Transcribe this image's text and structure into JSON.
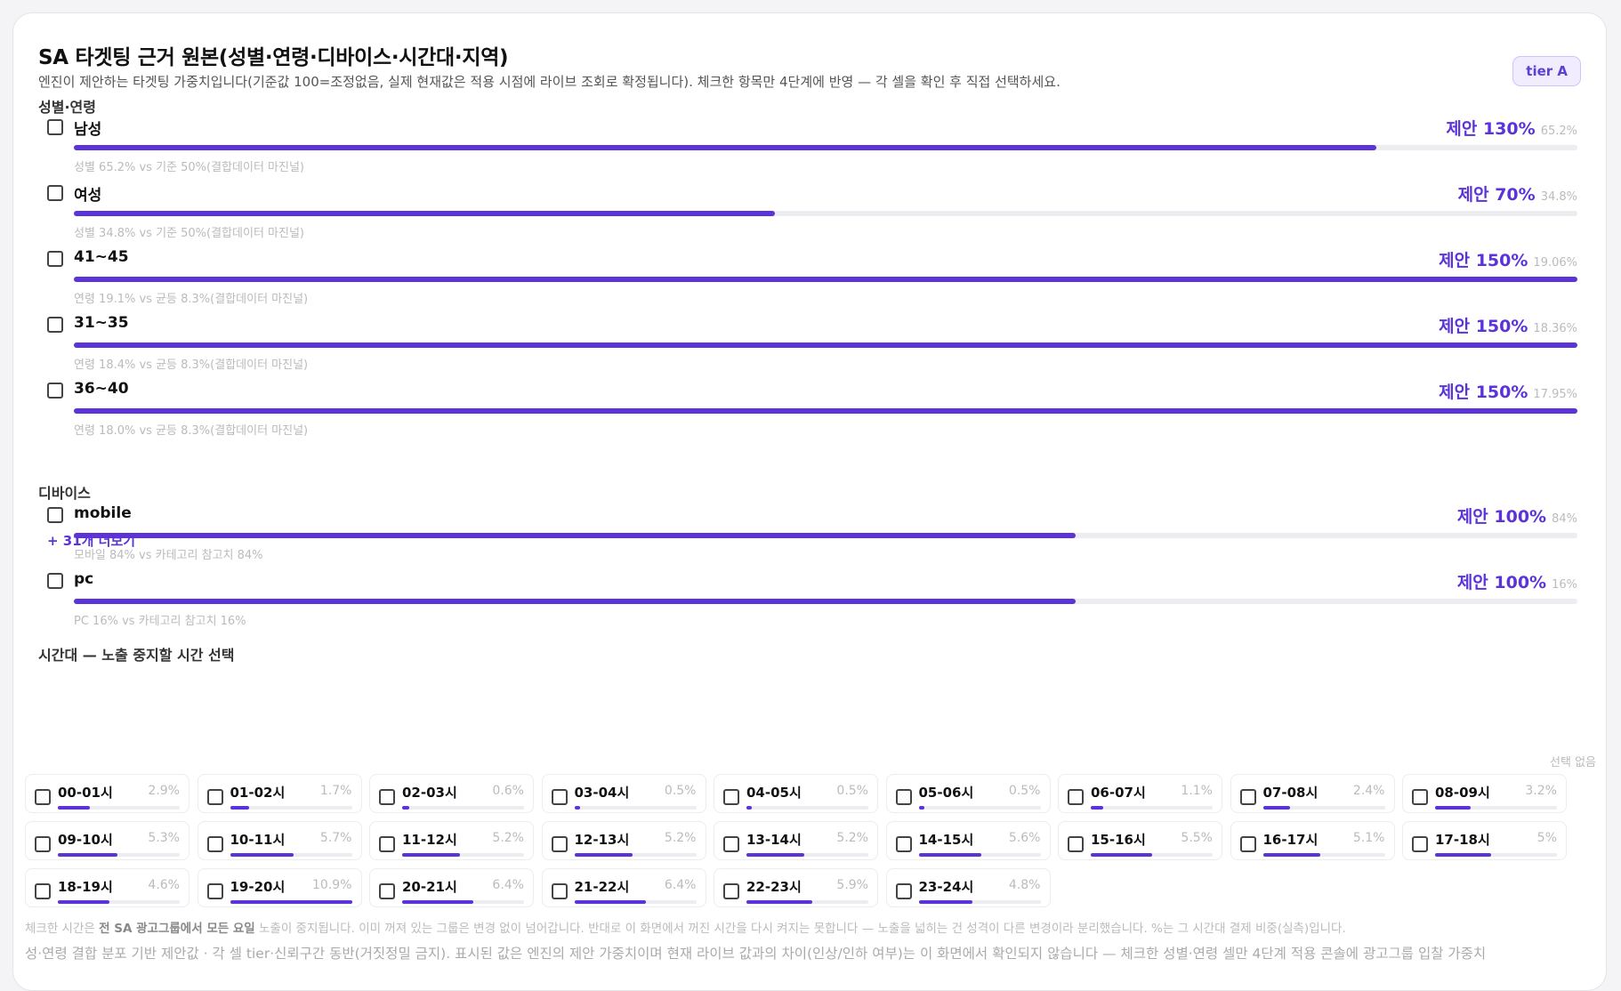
{
  "header": {
    "title": "SA 타겟팅 근거 원본(성별·연령·디바이스·시간대·지역)",
    "subtitle": "엔진이 제안하는 타겟팅 가중치입니다(기준값 100=조정없음, 실제 현재값은 적용 시점에 라이브 조회로 확정됩니다). 체크한 항목만 4단계에 반영 — 각 셀을 확인 후 직접 선택하세요.",
    "tier_badge": "tier A"
  },
  "sections": {
    "gender_age": "성별·연령",
    "device": "디바이스",
    "timeslot": "시간대 — 노출 중지할 시간 선택",
    "timeslot_status": "선택 없음"
  },
  "gender_age_rows": [
    {
      "label": "남성",
      "suggest": "제안 130%",
      "pct": "65.2%",
      "bar": 0.866,
      "note": "성별 65.2% vs 기준 50%(결합데이터 마진널)"
    },
    {
      "label": "여성",
      "suggest": "제안 70%",
      "pct": "34.8%",
      "bar": 0.466,
      "note": "성별 34.8% vs 기준 50%(결합데이터 마진널)"
    },
    {
      "label": "41~45",
      "suggest": "제안 150%",
      "pct": "19.06%",
      "bar": 1.0,
      "note": "연령 19.1% vs 균등 8.3%(결합데이터 마진널)"
    },
    {
      "label": "31~35",
      "suggest": "제안 150%",
      "pct": "18.36%",
      "bar": 1.0,
      "note": "연령 18.4% vs 균등 8.3%(결합데이터 마진널)"
    },
    {
      "label": "36~40",
      "suggest": "제안 150%",
      "pct": "17.95%",
      "bar": 1.0,
      "note": "연령 18.0% vs 균등 8.3%(결합데이터 마진널)"
    }
  ],
  "more_link": "+ 31개 더보기",
  "device_rows": [
    {
      "label": "mobile",
      "suggest": "제안 100%",
      "pct": "84%",
      "bar": 0.666,
      "note": "모바일 84% vs 카테고리 참고치 84%"
    },
    {
      "label": "pc",
      "suggest": "제안 100%",
      "pct": "16%",
      "bar": 0.666,
      "note": "PC 16% vs 카테고리 참고치 16%"
    }
  ],
  "timeslots": [
    {
      "label": "00-01시",
      "pct": "2.9%",
      "bar": 0.266
    },
    {
      "label": "01-02시",
      "pct": "1.7%",
      "bar": 0.156
    },
    {
      "label": "02-03시",
      "pct": "0.6%",
      "bar": 0.055
    },
    {
      "label": "03-04시",
      "pct": "0.5%",
      "bar": 0.046
    },
    {
      "label": "04-05시",
      "pct": "0.5%",
      "bar": 0.046
    },
    {
      "label": "05-06시",
      "pct": "0.5%",
      "bar": 0.046
    },
    {
      "label": "06-07시",
      "pct": "1.1%",
      "bar": 0.101
    },
    {
      "label": "07-08시",
      "pct": "2.4%",
      "bar": 0.22
    },
    {
      "label": "08-09시",
      "pct": "3.2%",
      "bar": 0.294
    },
    {
      "label": "09-10시",
      "pct": "5.3%",
      "bar": 0.486
    },
    {
      "label": "10-11시",
      "pct": "5.7%",
      "bar": 0.523
    },
    {
      "label": "11-12시",
      "pct": "5.2%",
      "bar": 0.477
    },
    {
      "label": "12-13시",
      "pct": "5.2%",
      "bar": 0.477
    },
    {
      "label": "13-14시",
      "pct": "5.2%",
      "bar": 0.477
    },
    {
      "label": "14-15시",
      "pct": "5.6%",
      "bar": 0.514
    },
    {
      "label": "15-16시",
      "pct": "5.5%",
      "bar": 0.505
    },
    {
      "label": "16-17시",
      "pct": "5.1%",
      "bar": 0.468
    },
    {
      "label": "17-18시",
      "pct": "5%",
      "bar": 0.459
    },
    {
      "label": "18-19시",
      "pct": "4.6%",
      "bar": 0.422
    },
    {
      "label": "19-20시",
      "pct": "10.9%",
      "bar": 1.0
    },
    {
      "label": "20-21시",
      "pct": "6.4%",
      "bar": 0.587
    },
    {
      "label": "21-22시",
      "pct": "6.4%",
      "bar": 0.587
    },
    {
      "label": "22-23시",
      "pct": "5.9%",
      "bar": 0.541
    },
    {
      "label": "23-24시",
      "pct": "4.8%",
      "bar": 0.44
    }
  ],
  "footer": {
    "note_prefix": "체크한 시간은 ",
    "note_bold": "전 SA 광고그룹에서 모든 요일",
    "note_suffix": " 노출이 중지됩니다. 이미 꺼져 있는 그룹은 변경 없이 넘어갑니다. 반대로 이 화면에서 꺼진 시간을 다시 켜지는 못합니다 — 노출을 넓히는 건 성격이 다른 변경이라 분리했습니다. %는 그 시간대 결제 비중(실측)입니다.",
    "disclaimer": "성·연령 결합 분포 기반 제안값 · 각 셀 tier·신뢰구간 동반(거짓정밀 금지). 표시된 값은 엔진의 제안 가중치이며 현재 라이브 값과의 차이(인상/인하 여부)는 이 화면에서 확인되지 않습니다 — 체크한 성별·연령 셀만 4단계 적용 콘솔에 광고그룹 입찰 가중치"
  },
  "colors": {
    "accent": "#5b33d8",
    "track": "#ececf1",
    "muted": "#bbbbbb"
  }
}
